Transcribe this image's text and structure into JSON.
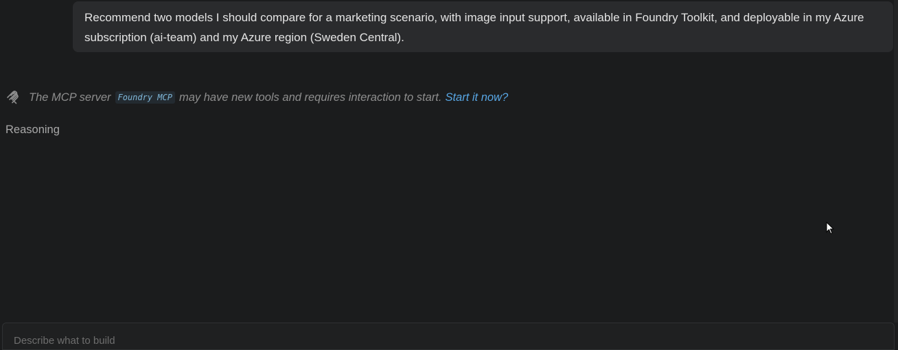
{
  "chat": {
    "user_message": {
      "text": "Recommend two models I should compare for a marketing scenario, with image input support, available in Foundry Toolkit, and deployable in my Azure subscription (ai-team) and my Azure region (Sweden Central)."
    },
    "mcp_notice": {
      "icon": "mcp-plug-icon",
      "prefix": "The MCP server",
      "server_name": "Foundry MCP",
      "suffix": "may have new tools and requires interaction to start.",
      "link_label": "Start it now?"
    },
    "reasoning_label": "Reasoning"
  },
  "input": {
    "placeholder": "Describe what to build"
  },
  "colors": {
    "background": "#1b1c1d",
    "bubble": "#2a2b2d",
    "link": "#58a6e4",
    "code_text": "#7fb6d8"
  }
}
